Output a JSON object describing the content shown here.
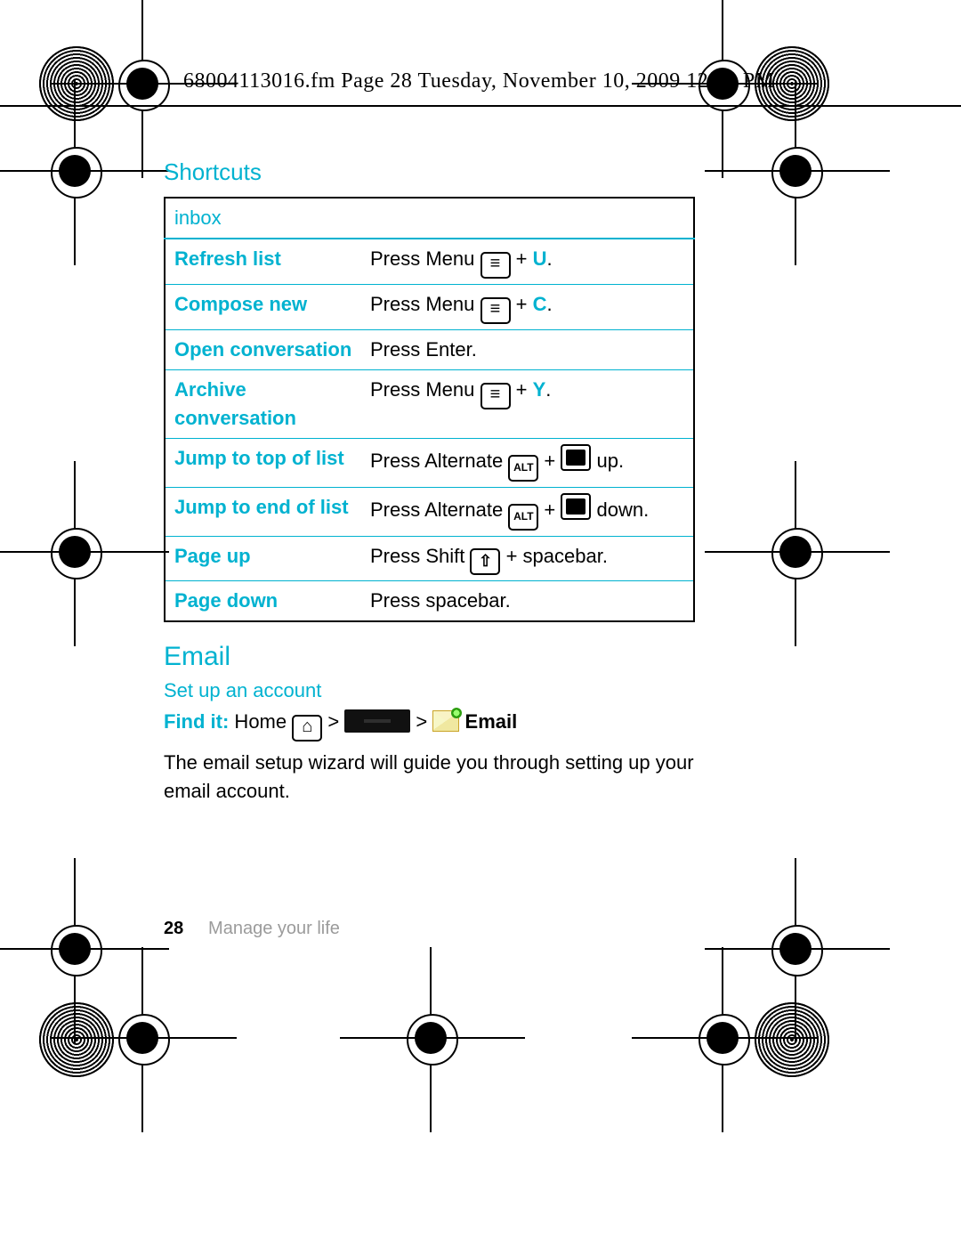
{
  "header_stamp": "68004113016.fm  Page 28  Tuesday, November 10, 2009  12:13 PM",
  "section_title": "Shortcuts",
  "table_header": "inbox",
  "rows": [
    {
      "label": "Refresh list",
      "action_pre": "Press Menu ",
      "icon1": "menu",
      "mid": " + ",
      "key": "U",
      "post": "."
    },
    {
      "label": "Compose new",
      "action_pre": "Press Menu ",
      "icon1": "menu",
      "mid": " + ",
      "key": "C",
      "post": "."
    },
    {
      "label": "Open conversation",
      "action_pre": "Press Enter.",
      "icon1": "",
      "mid": "",
      "key": "",
      "post": ""
    },
    {
      "label": "Archive conversation",
      "action_pre": "Press Menu ",
      "icon1": "menu",
      "mid": " + ",
      "key": "Y",
      "post": "."
    },
    {
      "label": "Jump to top of list",
      "action_pre": "Press Alternate ",
      "icon1": "alt",
      "mid": " + ",
      "icon2": "dpad",
      "post": " up."
    },
    {
      "label": "Jump to end of list",
      "action_pre": "Press Alternate ",
      "icon1": "alt",
      "mid": "  +  ",
      "icon2": "dpad",
      "post": " down."
    },
    {
      "label": "Page up",
      "action_pre": "Press Shift ",
      "icon1": "shift",
      "mid": " + spacebar.",
      "post": ""
    },
    {
      "label": "Page down",
      "action_pre": "Press spacebar.",
      "icon1": "",
      "mid": "",
      "post": ""
    }
  ],
  "email_heading": "Email",
  "email_sub": "Set up an account",
  "findit_label": "Find it:",
  "findit_home": " Home ",
  "findit_gt": " > ",
  "findit_email": "Email",
  "email_body": "The email setup wizard will guide you through setting up your email account.",
  "footer_page": "28",
  "footer_text": "Manage your life"
}
